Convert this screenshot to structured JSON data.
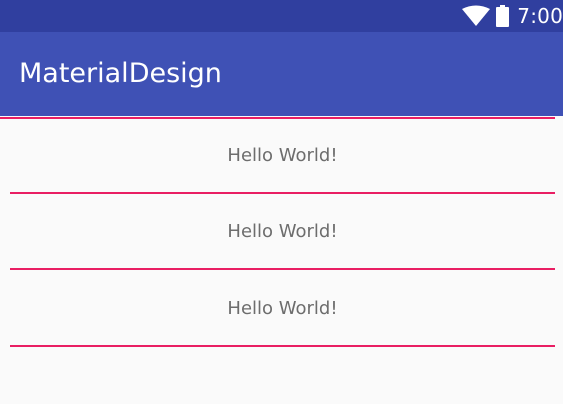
{
  "status_bar": {
    "time": "7:00",
    "icons": [
      "wifi-icon",
      "battery-icon"
    ]
  },
  "toolbar": {
    "title": "MaterialDesign"
  },
  "list": {
    "items": [
      {
        "text": "Hello World!"
      },
      {
        "text": "Hello World!"
      },
      {
        "text": "Hello World!"
      }
    ]
  },
  "colors": {
    "status_bar": "#303f9f",
    "toolbar": "#3f51b5",
    "divider": "#e91e63",
    "background": "#fafafa",
    "item_text": "#6d6d6d"
  }
}
